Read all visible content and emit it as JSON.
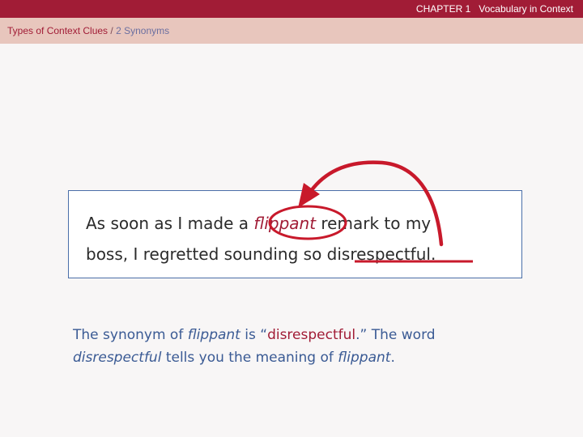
{
  "header": {
    "chapter_label": "CHAPTER 1   Vocabulary in Context",
    "breadcrumb_part1": "Types of Context Clues",
    "breadcrumb_sep": " / ",
    "breadcrumb_part2": "2 Synonyms"
  },
  "example": {
    "line1_before": "As soon as I made a ",
    "target_word": "flippant",
    "line1_after": " remark to my",
    "line2_before": "boss, I regretted sounding so ",
    "synonym_word": "disrespectful",
    "line2_after": "."
  },
  "explanation": {
    "s1": "The synonym of ",
    "s2": "flippant",
    "s3": " is “",
    "s4": "disrespectful",
    "s5": ".” The word ",
    "s6": "disrespectful",
    "s7": " tells you the meaning of ",
    "s8": "flippant",
    "s9": "."
  },
  "colors": {
    "accent": "#a11c36",
    "header_band": "#e8c6bd",
    "body_text": "#3a5a94"
  },
  "annotations": {
    "circle": "target-word-circle",
    "arrow": "curved-arrow-icon",
    "underline": "synonym-underline"
  }
}
